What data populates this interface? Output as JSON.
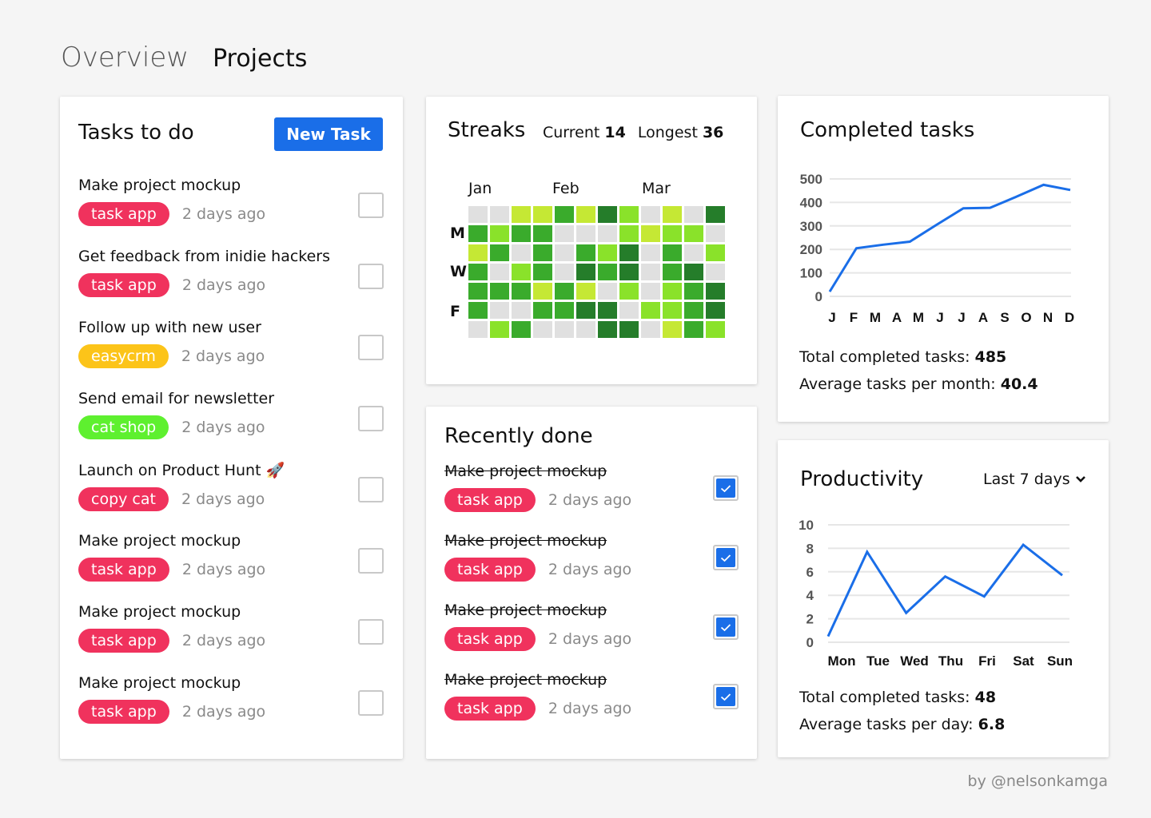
{
  "nav": {
    "overview": "Overview",
    "projects": "Projects"
  },
  "tasks": {
    "title": "Tasks to do",
    "new_task_label": "New Task",
    "items": [
      {
        "title": "Make project mockup",
        "tag": "task app",
        "tag_color": "#f0325d",
        "ago": "2 days ago"
      },
      {
        "title": "Get feedback from inidie hackers",
        "tag": "task app",
        "tag_color": "#f0325d",
        "ago": "2 days ago"
      },
      {
        "title": "Follow up with new user",
        "tag": "easycrm",
        "tag_color": "#fcc419",
        "ago": "2 days ago"
      },
      {
        "title": "Send email for newsletter",
        "tag": "cat shop",
        "tag_color": "#5ef02f",
        "ago": "2 days ago"
      },
      {
        "title": "Launch on Product Hunt 🚀",
        "tag": "copy cat",
        "tag_color": "#f0325d",
        "ago": "2 days ago"
      },
      {
        "title": "Make project mockup",
        "tag": "task app",
        "tag_color": "#f0325d",
        "ago": "2 days ago"
      },
      {
        "title": "Make project mockup",
        "tag": "task app",
        "tag_color": "#f0325d",
        "ago": "2 days ago"
      },
      {
        "title": "Make project mockup",
        "tag": "task app",
        "tag_color": "#f0325d",
        "ago": "2 days ago"
      }
    ]
  },
  "streaks": {
    "title": "Streaks",
    "current_label": "Current",
    "current_value": "14",
    "longest_label": "Longest",
    "longest_value": "36",
    "months": [
      "Jan",
      "Feb",
      "Mar"
    ],
    "day_labels": [
      "M",
      "W",
      "F"
    ],
    "palette": [
      "#e0e0e0",
      "#c5e834",
      "#8ae22a",
      "#3aab2c",
      "#257d2a"
    ],
    "grid": [
      [
        0,
        0,
        1,
        1,
        3,
        1,
        4,
        2,
        0,
        1,
        0,
        4
      ],
      [
        3,
        2,
        3,
        3,
        0,
        0,
        0,
        2,
        1,
        2,
        2,
        0
      ],
      [
        1,
        3,
        0,
        3,
        0,
        3,
        2,
        4,
        0,
        3,
        0,
        2
      ],
      [
        3,
        0,
        2,
        3,
        0,
        4,
        3,
        4,
        0,
        3,
        4,
        0
      ],
      [
        3,
        3,
        3,
        1,
        3,
        1,
        0,
        2,
        0,
        2,
        3,
        4
      ],
      [
        3,
        0,
        0,
        3,
        3,
        4,
        4,
        0,
        2,
        2,
        3,
        4
      ],
      [
        0,
        2,
        3,
        0,
        0,
        0,
        4,
        4,
        0,
        1,
        3,
        2
      ]
    ]
  },
  "recently_done": {
    "title": "Recently done",
    "items": [
      {
        "title": "Make project mockup",
        "tag": "task app",
        "tag_color": "#f0325d",
        "ago": "2 days ago"
      },
      {
        "title": "Make project mockup",
        "tag": "task app",
        "tag_color": "#f0325d",
        "ago": "2 days ago"
      },
      {
        "title": "Make project mockup",
        "tag": "task app",
        "tag_color": "#f0325d",
        "ago": "2 days ago"
      },
      {
        "title": "Make project mockup",
        "tag": "task app",
        "tag_color": "#f0325d",
        "ago": "2 days ago"
      }
    ]
  },
  "completed": {
    "title": "Completed tasks",
    "total_label": "Total completed tasks:",
    "total_value": "485",
    "avg_label": "Average tasks per month:",
    "avg_value": "40.4",
    "chart_data": {
      "type": "line",
      "categories": [
        "J",
        "F",
        "M",
        "A",
        "M",
        "J",
        "J",
        "A",
        "S",
        "O",
        "N",
        "D"
      ],
      "values": [
        20,
        205,
        220,
        233,
        305,
        375,
        377,
        425,
        475,
        453
      ],
      "ylim": [
        0,
        500
      ],
      "yticks": [
        0,
        100,
        200,
        300,
        400,
        500
      ],
      "color": "#1a6ee8",
      "grid": true
    }
  },
  "productivity": {
    "title": "Productivity",
    "range_label": "Last 7 days",
    "total_label": "Total completed tasks:",
    "total_value": "48",
    "avg_label": "Average tasks per day:",
    "avg_value": "6.8",
    "chart_data": {
      "type": "line",
      "categories": [
        "Mon",
        "Tue",
        "Wed",
        "Thu",
        "Fri",
        "Sat",
        "Sun"
      ],
      "values": [
        0.5,
        7.7,
        2.5,
        5.6,
        3.9,
        8.3,
        5.7
      ],
      "ylim": [
        0,
        10
      ],
      "yticks": [
        0,
        2,
        4,
        6,
        8,
        10
      ],
      "color": "#1a6ee8",
      "grid": true
    }
  },
  "credit": "by @nelsonkamga"
}
